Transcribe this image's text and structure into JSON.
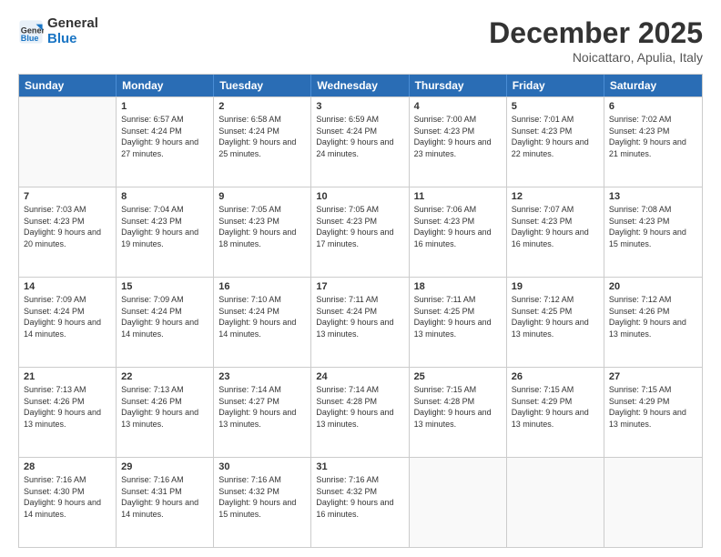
{
  "logo": {
    "line1": "General",
    "line2": "Blue"
  },
  "title": "December 2025",
  "location": "Noicattaro, Apulia, Italy",
  "weekdays": [
    "Sunday",
    "Monday",
    "Tuesday",
    "Wednesday",
    "Thursday",
    "Friday",
    "Saturday"
  ],
  "weeks": [
    [
      {
        "day": "",
        "empty": true
      },
      {
        "day": "1",
        "sunrise": "6:57 AM",
        "sunset": "4:24 PM",
        "daylight": "9 hours and 27 minutes."
      },
      {
        "day": "2",
        "sunrise": "6:58 AM",
        "sunset": "4:24 PM",
        "daylight": "9 hours and 25 minutes."
      },
      {
        "day": "3",
        "sunrise": "6:59 AM",
        "sunset": "4:24 PM",
        "daylight": "9 hours and 24 minutes."
      },
      {
        "day": "4",
        "sunrise": "7:00 AM",
        "sunset": "4:23 PM",
        "daylight": "9 hours and 23 minutes."
      },
      {
        "day": "5",
        "sunrise": "7:01 AM",
        "sunset": "4:23 PM",
        "daylight": "9 hours and 22 minutes."
      },
      {
        "day": "6",
        "sunrise": "7:02 AM",
        "sunset": "4:23 PM",
        "daylight": "9 hours and 21 minutes."
      }
    ],
    [
      {
        "day": "7",
        "sunrise": "7:03 AM",
        "sunset": "4:23 PM",
        "daylight": "9 hours and 20 minutes."
      },
      {
        "day": "8",
        "sunrise": "7:04 AM",
        "sunset": "4:23 PM",
        "daylight": "9 hours and 19 minutes."
      },
      {
        "day": "9",
        "sunrise": "7:05 AM",
        "sunset": "4:23 PM",
        "daylight": "9 hours and 18 minutes."
      },
      {
        "day": "10",
        "sunrise": "7:05 AM",
        "sunset": "4:23 PM",
        "daylight": "9 hours and 17 minutes."
      },
      {
        "day": "11",
        "sunrise": "7:06 AM",
        "sunset": "4:23 PM",
        "daylight": "9 hours and 16 minutes."
      },
      {
        "day": "12",
        "sunrise": "7:07 AM",
        "sunset": "4:23 PM",
        "daylight": "9 hours and 16 minutes."
      },
      {
        "day": "13",
        "sunrise": "7:08 AM",
        "sunset": "4:23 PM",
        "daylight": "9 hours and 15 minutes."
      }
    ],
    [
      {
        "day": "14",
        "sunrise": "7:09 AM",
        "sunset": "4:24 PM",
        "daylight": "9 hours and 14 minutes."
      },
      {
        "day": "15",
        "sunrise": "7:09 AM",
        "sunset": "4:24 PM",
        "daylight": "9 hours and 14 minutes."
      },
      {
        "day": "16",
        "sunrise": "7:10 AM",
        "sunset": "4:24 PM",
        "daylight": "9 hours and 14 minutes."
      },
      {
        "day": "17",
        "sunrise": "7:11 AM",
        "sunset": "4:24 PM",
        "daylight": "9 hours and 13 minutes."
      },
      {
        "day": "18",
        "sunrise": "7:11 AM",
        "sunset": "4:25 PM",
        "daylight": "9 hours and 13 minutes."
      },
      {
        "day": "19",
        "sunrise": "7:12 AM",
        "sunset": "4:25 PM",
        "daylight": "9 hours and 13 minutes."
      },
      {
        "day": "20",
        "sunrise": "7:12 AM",
        "sunset": "4:26 PM",
        "daylight": "9 hours and 13 minutes."
      }
    ],
    [
      {
        "day": "21",
        "sunrise": "7:13 AM",
        "sunset": "4:26 PM",
        "daylight": "9 hours and 13 minutes."
      },
      {
        "day": "22",
        "sunrise": "7:13 AM",
        "sunset": "4:26 PM",
        "daylight": "9 hours and 13 minutes."
      },
      {
        "day": "23",
        "sunrise": "7:14 AM",
        "sunset": "4:27 PM",
        "daylight": "9 hours and 13 minutes."
      },
      {
        "day": "24",
        "sunrise": "7:14 AM",
        "sunset": "4:28 PM",
        "daylight": "9 hours and 13 minutes."
      },
      {
        "day": "25",
        "sunrise": "7:15 AM",
        "sunset": "4:28 PM",
        "daylight": "9 hours and 13 minutes."
      },
      {
        "day": "26",
        "sunrise": "7:15 AM",
        "sunset": "4:29 PM",
        "daylight": "9 hours and 13 minutes."
      },
      {
        "day": "27",
        "sunrise": "7:15 AM",
        "sunset": "4:29 PM",
        "daylight": "9 hours and 13 minutes."
      }
    ],
    [
      {
        "day": "28",
        "sunrise": "7:16 AM",
        "sunset": "4:30 PM",
        "daylight": "9 hours and 14 minutes."
      },
      {
        "day": "29",
        "sunrise": "7:16 AM",
        "sunset": "4:31 PM",
        "daylight": "9 hours and 14 minutes."
      },
      {
        "day": "30",
        "sunrise": "7:16 AM",
        "sunset": "4:32 PM",
        "daylight": "9 hours and 15 minutes."
      },
      {
        "day": "31",
        "sunrise": "7:16 AM",
        "sunset": "4:32 PM",
        "daylight": "9 hours and 16 minutes."
      },
      {
        "day": "",
        "empty": true
      },
      {
        "day": "",
        "empty": true
      },
      {
        "day": "",
        "empty": true
      }
    ]
  ]
}
